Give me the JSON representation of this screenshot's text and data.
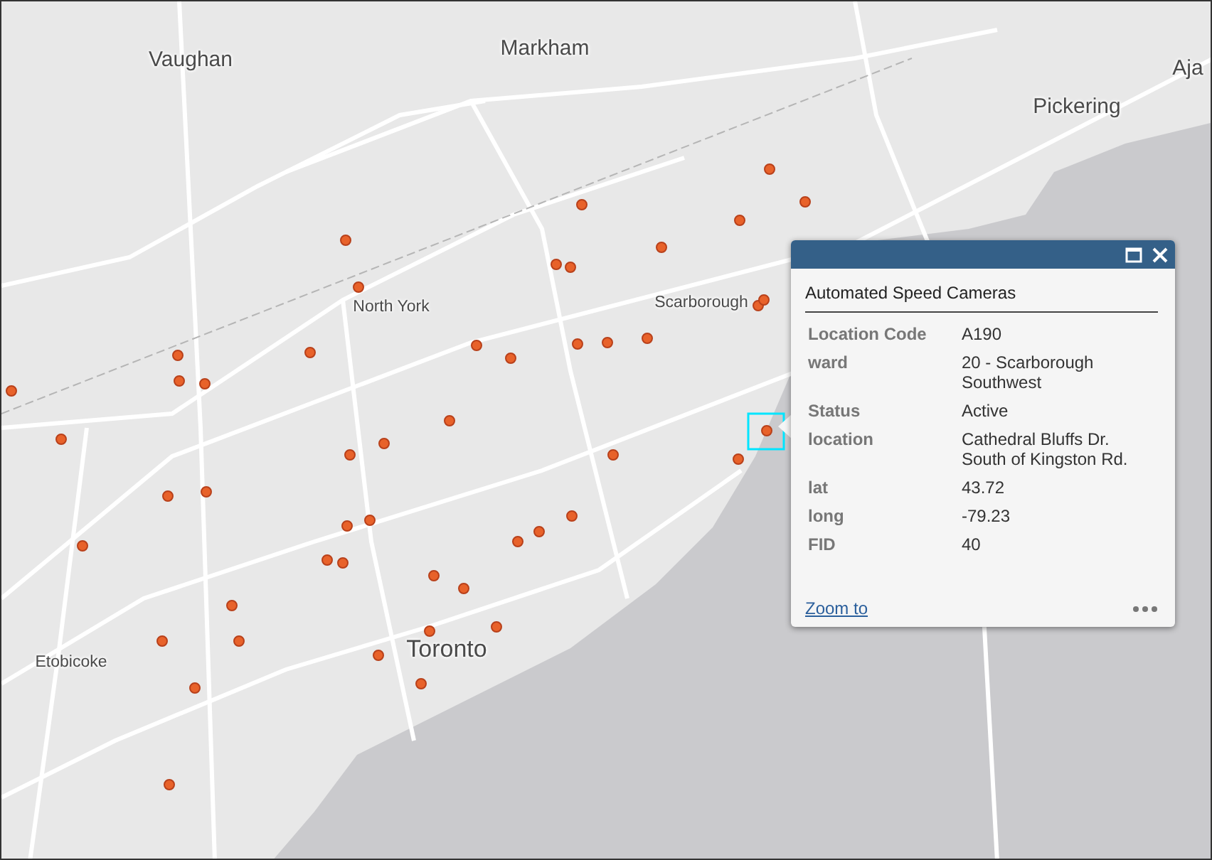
{
  "map_labels": [
    {
      "text": "Vaughan",
      "kind": "city"
    },
    {
      "text": "Markham",
      "kind": "city"
    },
    {
      "text": "Aja",
      "kind": "city"
    },
    {
      "text": "Pickering",
      "kind": "city"
    },
    {
      "text": "North York",
      "kind": "district"
    },
    {
      "text": "Scarborough",
      "kind": "district"
    },
    {
      "text": "Toronto",
      "kind": "major"
    },
    {
      "text": "Etobicoke",
      "kind": "district"
    }
  ],
  "popup": {
    "title": "Automated Speed Cameras",
    "fields": [
      {
        "label": "Location Code",
        "value": "A190"
      },
      {
        "label": "ward",
        "value": "20 - Scarborough Southwest"
      },
      {
        "label": "Status",
        "value": "Active"
      },
      {
        "label": "location",
        "value": "Cathedral Bluffs Dr. South of Kingston Rd."
      },
      {
        "label": "lat",
        "value": "43.72"
      },
      {
        "label": "long",
        "value": "-79.23"
      },
      {
        "label": "FID",
        "value": "40"
      }
    ],
    "link": "Zoom to"
  }
}
